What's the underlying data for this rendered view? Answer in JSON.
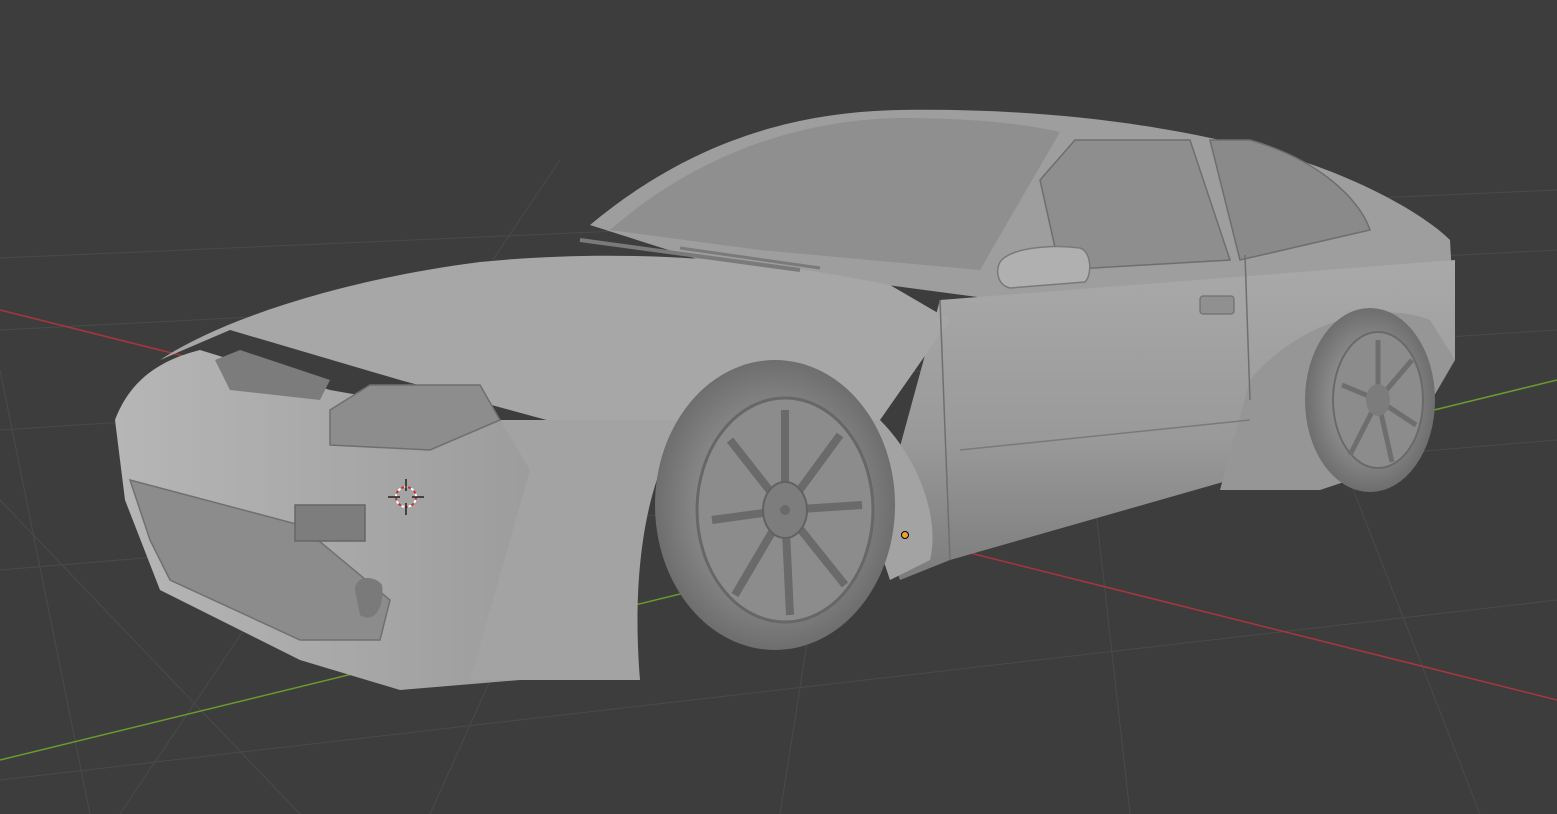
{
  "viewport": {
    "background": "#3d3d3d",
    "shading_mode": "solid",
    "grid": {
      "color": "#4a4a4a",
      "x_axis_color": "#a8353f",
      "y_axis_color": "#6b9a2f"
    },
    "objects": [
      {
        "name": "car-body",
        "icon": "mesh-object-icon",
        "color": "#9b9b9b"
      },
      {
        "name": "front-wheel",
        "icon": "mesh-object-icon",
        "color": "#8f8f8f"
      },
      {
        "name": "rear-wheel",
        "icon": "mesh-object-icon",
        "color": "#8f8f8f"
      }
    ],
    "cursor_3d": {
      "icon": "3d-cursor-icon",
      "colors": [
        "#c83232",
        "#ffffff"
      ]
    },
    "origin_point": {
      "icon": "object-origin-icon",
      "color": "#f0a030"
    }
  }
}
